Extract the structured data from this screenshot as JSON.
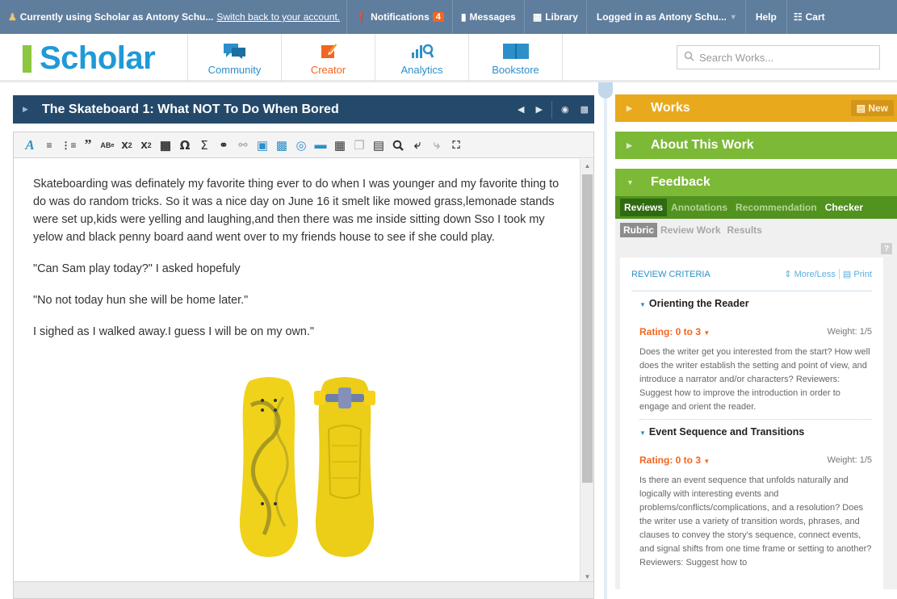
{
  "topbar": {
    "using_text": "Currently using Scholar as Antony Schu...",
    "switch_link": "Switch back to your account.",
    "notifications_label": "Notifications",
    "notifications_count": "4",
    "messages_label": "Messages",
    "library_label": "Library",
    "logged_in_label": "Logged in as Antony Schu...",
    "help_label": "Help",
    "cart_label": "Cart"
  },
  "header": {
    "logo_text": "Scholar",
    "nav": [
      {
        "label": "Community",
        "icon": "chat-bubbles-icon"
      },
      {
        "label": "Creator",
        "icon": "pencil-icon"
      },
      {
        "label": "Analytics",
        "icon": "chart-search-icon"
      },
      {
        "label": "Bookstore",
        "icon": "book-icon"
      }
    ],
    "search_placeholder": "Search Works..."
  },
  "editor": {
    "title": "The Skateboard 1: What NOT To Do When Bored",
    "paragraphs": [
      "Skateboarding was definately my favorite thing ever to do when I was younger and my favorite thing to do was do random tricks. So it was a nice day on June 16 it smelt like mowed grass,lemonade stands were set up,kids were yelling and laughing,and then there was me inside sitting down Sso I took my yelow and black penny board aand went over to my friends house to see if she could play.",
      "\"Can Sam play today?\" I asked hopefuly",
      "\"No not today hun she will be home later.\"",
      "I sighed as I walked away.I guess I will be on my own.\""
    ],
    "toolbar_icons": [
      "font-style-icon",
      "numbered-list-icon",
      "bulleted-list-icon",
      "blockquote-icon",
      "ordinal-icon",
      "superscript-icon",
      "subscript-icon",
      "table-icon",
      "omega-icon",
      "sigma-icon",
      "link-icon",
      "unlink-icon",
      "insert-image-icon",
      "insert-media-icon",
      "insert-audio-icon",
      "insert-video-icon",
      "insert-file-icon",
      "copy-icon",
      "paste-icon",
      "search-icon",
      "undo-icon",
      "redo-icon",
      "fullscreen-icon"
    ]
  },
  "sidebar": {
    "works_label": "Works",
    "new_label": "New",
    "about_label": "About This Work",
    "feedback_label": "Feedback",
    "feedback_tabs": [
      "Reviews",
      "Annotations",
      "Recommendation",
      "Checker"
    ],
    "sub_tabs": [
      "Rubric",
      "Review Work",
      "Results"
    ],
    "review_criteria_label": "REVIEW CRITERIA",
    "more_less_label": "More/Less",
    "print_label": "Print",
    "criteria": [
      {
        "name": "Orienting the Reader",
        "rating": "Rating: 0 to 3",
        "weight": "Weight: 1/5",
        "description": "Does the writer get you interested from the start? How well does the writer establish the setting and point of view, and introduce a narrator and/or characters? Reviewers: Suggest how to improve the introduction in order to engage and orient the reader."
      },
      {
        "name": "Event Sequence and Transitions",
        "rating": "Rating: 0 to 3",
        "weight": "Weight: 1/5",
        "description": "Is there an event sequence that unfolds naturally and logically with interesting events and problems/conflicts/complications, and a resolution? Does the writer use a variety of transition words, phrases, and clauses to convey the story's sequence, connect events, and signal shifts from one time frame or setting to another? Reviewers: Suggest how to"
      }
    ]
  },
  "colors": {
    "topbar": "#5f7d9c",
    "brand_blue": "#1f9ad6",
    "brand_green": "#8dc63f",
    "title_bar": "#25496a",
    "works": "#e8a91d",
    "green": "#7cb936",
    "accent_orange": "#f26522"
  }
}
